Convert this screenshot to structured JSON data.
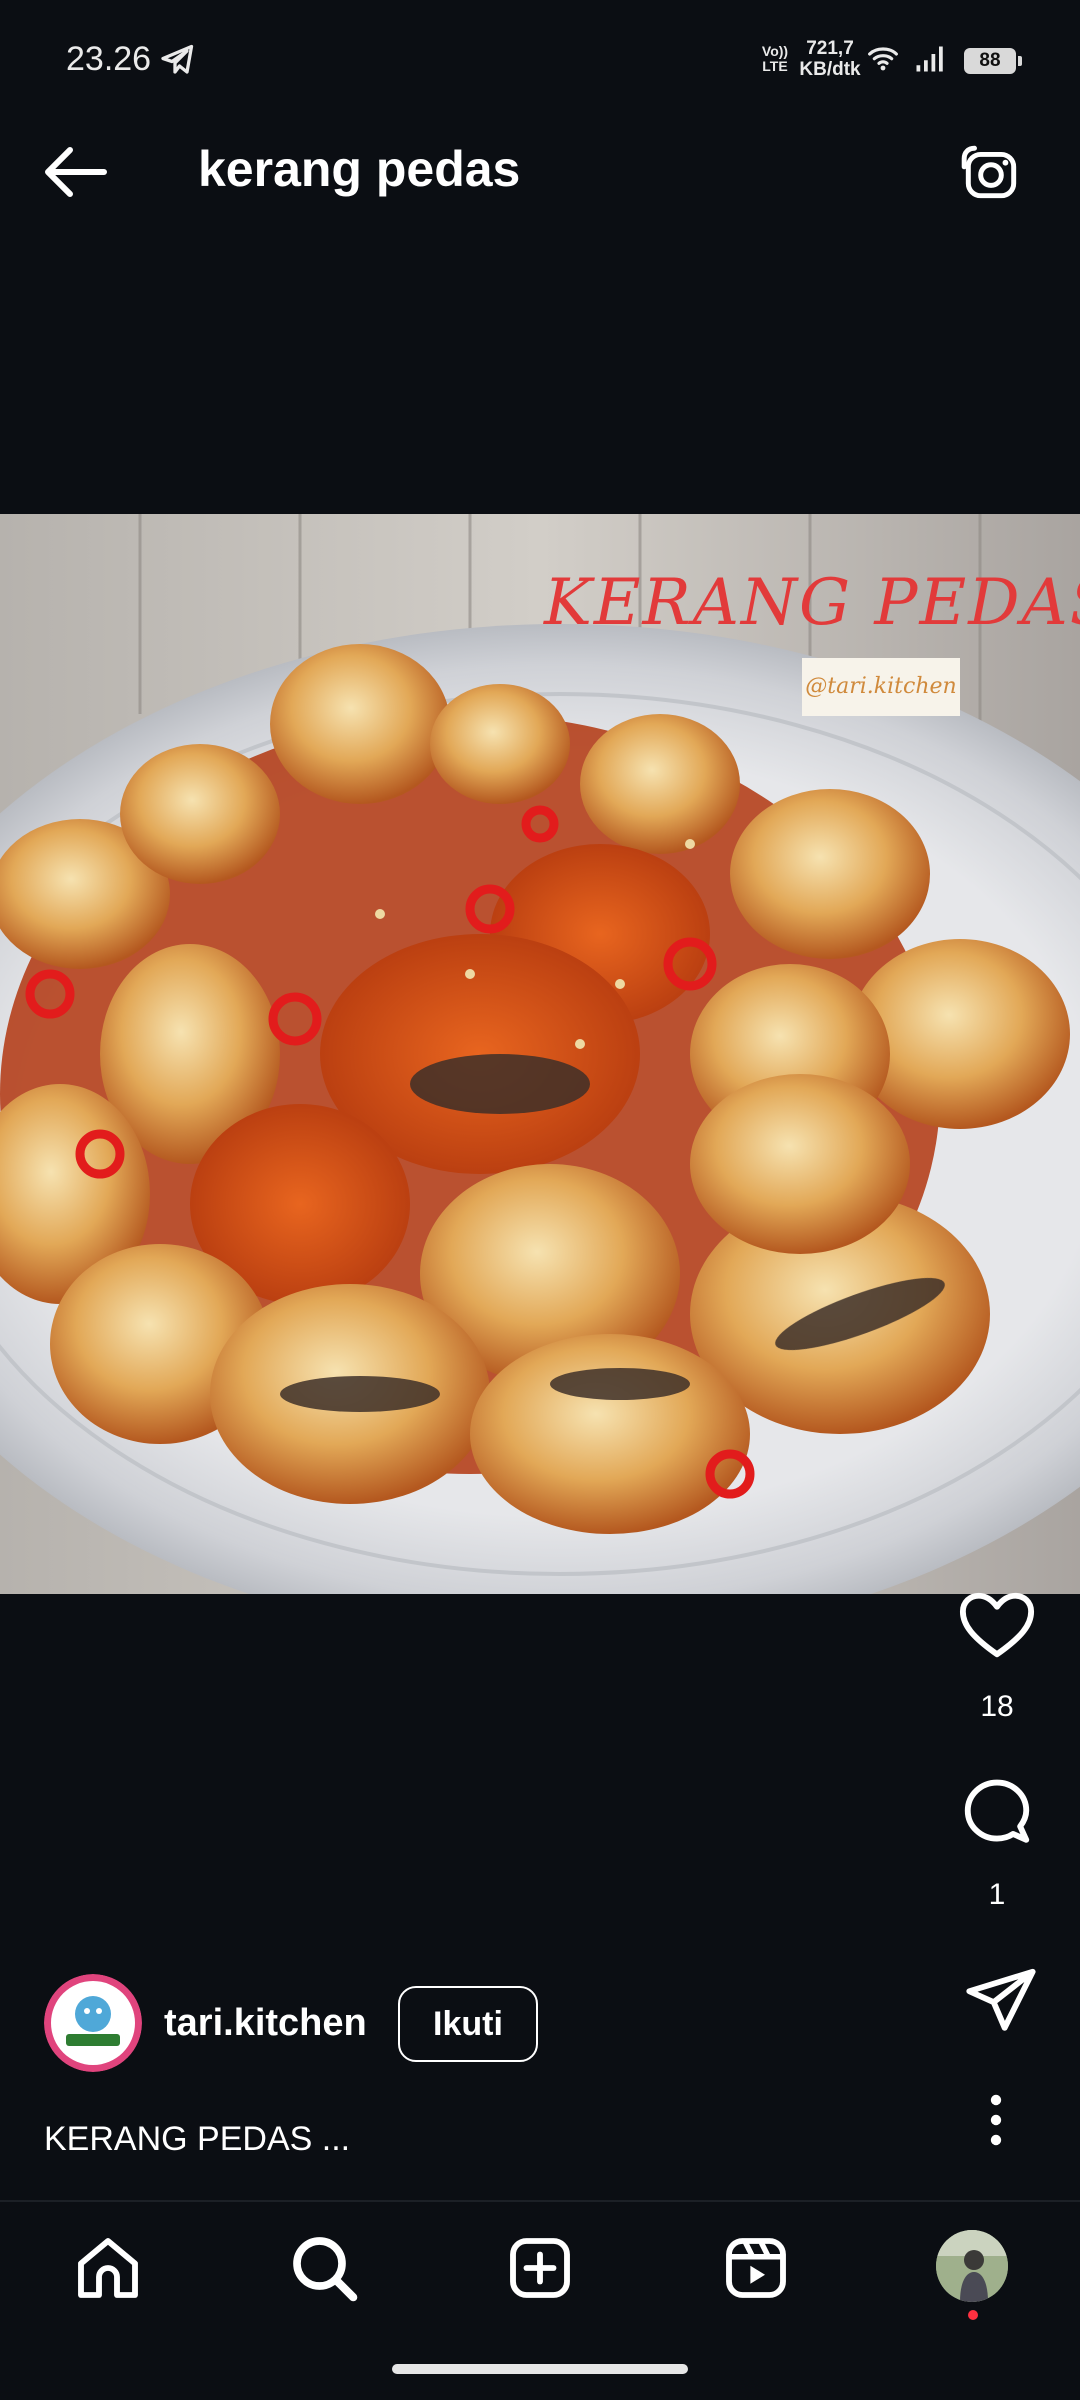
{
  "status_bar": {
    "time": "23.26",
    "network_type_line1": "Vo))",
    "network_type_line2": "LTE",
    "speed_value": "721,7",
    "speed_unit": "KB/dtk",
    "battery": "88",
    "icons": [
      "telegram-icon",
      "wifi-icon",
      "signal-icon",
      "battery-icon"
    ]
  },
  "header": {
    "title": "kerang pedas",
    "back_icon": "arrow-left-icon",
    "camera_icon": "camera-icon"
  },
  "post": {
    "image_overlay_title": "KERANG PEDAS",
    "image_overlay_tag": "@tari.kitchen",
    "likes": "18",
    "comments": "1",
    "author": "tari.kitchen",
    "follow_label": "Ikuti",
    "caption": "KERANG PEDAS ..."
  },
  "bottom_nav": {
    "items": [
      "home-icon",
      "search-icon",
      "create-icon",
      "reels-icon",
      "profile-avatar"
    ]
  },
  "colors": {
    "background": "#0b0e13",
    "notification_dot": "#ff3040",
    "overlay_title": "#e23a3a"
  }
}
